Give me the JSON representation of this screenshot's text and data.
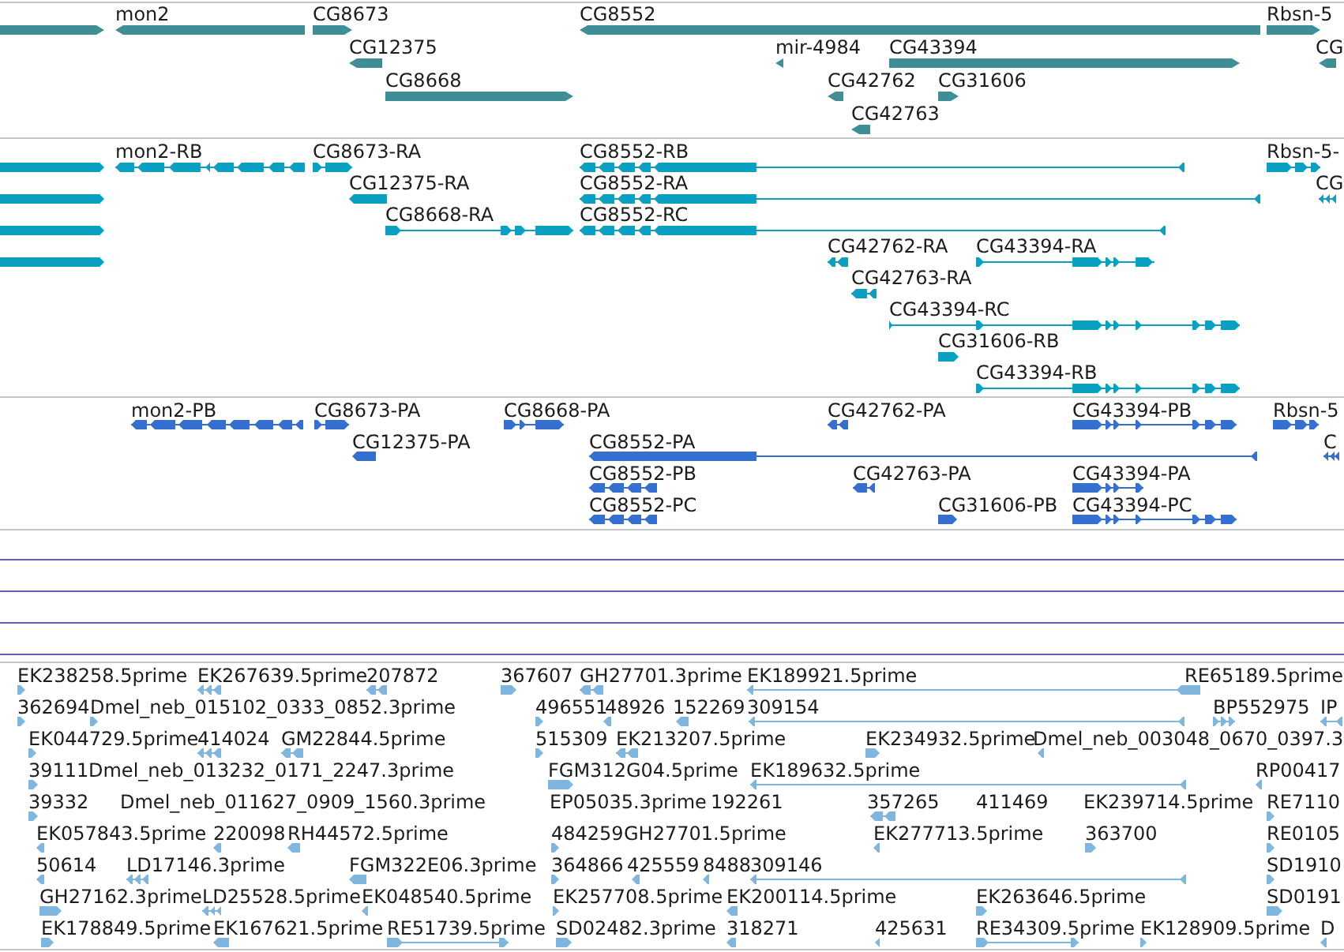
{
  "tracks": [
    {
      "kind": "gene",
      "rows": [
        {
          "features": [
            {
              "reverse": false
            },
            {
              "label": "mon2",
              "reverse": true
            },
            {
              "label": "CG8673",
              "reverse": false
            },
            {
              "label": "CG8552",
              "reverse": true
            },
            {
              "label": "Rbsn-5",
              "reverse": false
            }
          ]
        },
        {
          "features": [
            {
              "label": "CG12375",
              "reverse": true
            },
            {
              "label": "mir-4984",
              "reverse": true
            },
            {
              "label": "CG43394",
              "reverse": false
            },
            {
              "label": "CG",
              "reverse": true
            }
          ]
        },
        {
          "features": [
            {
              "label": "CG8668",
              "reverse": false
            },
            {
              "label": "CG42762",
              "reverse": true
            },
            {
              "label": "CG31606",
              "reverse": false
            }
          ]
        },
        {
          "features": [
            {
              "label": "CG42763",
              "reverse": true
            }
          ]
        }
      ]
    },
    {
      "kind": "transcript",
      "rows": [
        {
          "features": [
            {
              "reverse": false
            },
            {
              "label": "mon2-RB",
              "reverse": true
            },
            {
              "label": "CG8673-RA",
              "reverse": false
            },
            {
              "label": "CG8552-RB",
              "reverse": true
            },
            {
              "label": "Rbsn-5-",
              "reverse": false
            }
          ]
        },
        {
          "features": [
            {
              "reverse": false
            },
            {
              "label": "CG12375-RA",
              "reverse": true
            },
            {
              "label": "CG8552-RA",
              "reverse": true
            },
            {
              "label": "CG",
              "reverse": true
            }
          ]
        },
        {
          "features": [
            {
              "reverse": false
            },
            {
              "label": "CG8668-RA",
              "reverse": false
            },
            {
              "label": "CG8552-RC",
              "reverse": true
            }
          ]
        },
        {
          "features": [
            {
              "reverse": false
            },
            {
              "label": "CG42762-RA",
              "reverse": true
            },
            {
              "label": "CG43394-RA",
              "reverse": false
            }
          ]
        },
        {
          "features": [
            {
              "label": "CG42763-RA",
              "reverse": true
            }
          ]
        },
        {
          "features": [
            {
              "label": "CG43394-RC",
              "reverse": false
            }
          ]
        },
        {
          "features": [
            {
              "label": "CG31606-RB",
              "reverse": false
            }
          ]
        },
        {
          "features": [
            {
              "label": "CG43394-RB",
              "reverse": false
            }
          ]
        }
      ]
    },
    {
      "kind": "protein",
      "rows": [
        {
          "features": [
            {
              "label": "mon2-PB",
              "reverse": true
            },
            {
              "label": "CG8673-PA",
              "reverse": false
            },
            {
              "label": "CG8668-PA",
              "reverse": false
            },
            {
              "label": "CG42762-PA",
              "reverse": true
            },
            {
              "label": "CG43394-PB",
              "reverse": false
            },
            {
              "label": "Rbsn-5",
              "reverse": false
            }
          ]
        },
        {
          "features": [
            {
              "label": "CG12375-PA",
              "reverse": true
            },
            {
              "label": "CG8552-PA",
              "reverse": true
            },
            {
              "label": "C",
              "reverse": true
            }
          ]
        },
        {
          "features": [
            {
              "label": "CG8552-PB",
              "reverse": true
            },
            {
              "label": "CG42763-PA",
              "reverse": true
            },
            {
              "label": "CG43394-PA",
              "reverse": false
            }
          ]
        },
        {
          "features": [
            {
              "label": "CG8552-PC",
              "reverse": true
            },
            {
              "label": "CG31606-PB",
              "reverse": false
            },
            {
              "label": "CG43394-PC",
              "reverse": false
            }
          ]
        }
      ]
    },
    {
      "kind": "empty"
    },
    {
      "kind": "empty"
    },
    {
      "kind": "empty"
    },
    {
      "kind": "empty"
    },
    {
      "kind": "est",
      "rows": [
        {
          "features": [
            {
              "label": "EK238258.5prime",
              "reverse": false
            },
            {
              "label": "EK267639.5prime",
              "reverse": true
            },
            {
              "label": "207872",
              "reverse": true
            },
            {
              "label": "367607",
              "reverse": false
            },
            {
              "label": "GH27701.3prime",
              "reverse": true
            },
            {
              "label": "EK189921.5prime",
              "reverse": true
            },
            {
              "label": "RE65189.5prime"
            }
          ]
        },
        {
          "features": [
            {
              "label": "362694",
              "reverse": false
            },
            {
              "label": "Dmel_neb_015102_0333_0852.3prime",
              "reverse": false
            },
            {
              "label": "496551",
              "reverse": false
            },
            {
              "label": "48926",
              "reverse": true
            },
            {
              "label": "152269",
              "reverse": true
            },
            {
              "label": "309154",
              "reverse": true
            },
            {
              "label": "BP552975",
              "reverse": false
            },
            {
              "label": "IP",
              "reverse": true
            }
          ]
        },
        {
          "features": [
            {
              "label": "EK044729.5prime",
              "reverse": false
            },
            {
              "label": "414024",
              "reverse": true
            },
            {
              "label": "GM22844.5prime",
              "reverse": true
            },
            {
              "label": "515309",
              "reverse": false
            },
            {
              "label": "EK213207.5prime",
              "reverse": true
            },
            {
              "label": "EK234932.5prime",
              "reverse": false
            },
            {
              "label": "Dmel_neb_003048_0670_0397.3",
              "reverse": true
            }
          ]
        },
        {
          "features": [
            {
              "label": "39111",
              "reverse": false
            },
            {
              "label": "Dmel_neb_013232_0171_2247.3prime"
            },
            {
              "label": "FGM312G04.5prime",
              "reverse": false
            },
            {
              "label": "EK189632.5prime",
              "reverse": true
            },
            {
              "label": "RP00417",
              "reverse": true
            }
          ]
        },
        {
          "features": [
            {
              "label": "39332",
              "reverse": false
            },
            {
              "label": "Dmel_neb_011627_0909_1560.3prime"
            },
            {
              "label": "EP05035.3prime"
            },
            {
              "label": "192261"
            },
            {
              "label": "357265",
              "reverse": true
            },
            {
              "label": "411469"
            },
            {
              "label": "EK239714.5prime"
            },
            {
              "label": "RE7110",
              "reverse": false
            }
          ]
        },
        {
          "features": [
            {
              "label": "EK057843.5prime",
              "reverse": true
            },
            {
              "label": "220098",
              "reverse": true
            },
            {
              "label": "RH44572.5prime",
              "reverse": true
            },
            {
              "label": "484259",
              "reverse": false
            },
            {
              "label": "GH27701.5prime"
            },
            {
              "label": "EK277713.5prime",
              "reverse": true
            },
            {
              "label": "363700",
              "reverse": false
            },
            {
              "label": "RE0105",
              "reverse": false
            }
          ]
        },
        {
          "features": [
            {
              "label": "50614",
              "reverse": true
            },
            {
              "label": "LD17146.3prime",
              "reverse": true
            },
            {
              "label": "FGM322E06.3prime",
              "reverse": true
            },
            {
              "label": "364866",
              "reverse": false
            },
            {
              "label": "425559",
              "reverse": true
            },
            {
              "label": "8488",
              "reverse": true
            },
            {
              "label": "309146",
              "reverse": true
            },
            {
              "label": "SD1910",
              "reverse": false
            }
          ]
        },
        {
          "features": [
            {
              "label": "GH27162.3prime",
              "reverse": false
            },
            {
              "label": "LD25528.5prime",
              "reverse": true
            },
            {
              "label": "EK048540.5prime",
              "reverse": true
            },
            {
              "label": "EK257708.5prime",
              "reverse": false
            },
            {
              "label": "EK200114.5prime",
              "reverse": true
            },
            {
              "label": "EK263646.5prime",
              "reverse": false
            },
            {
              "label": "SD0191",
              "reverse": false
            }
          ]
        },
        {
          "features": [
            {
              "label": "EK178849.5prime",
              "reverse": false
            },
            {
              "label": "EK167621.5prime",
              "reverse": true
            },
            {
              "label": "RE51739.5prime",
              "reverse": false
            },
            {
              "label": "SD02482.3prime",
              "reverse": false
            },
            {
              "label": "318271",
              "reverse": true
            },
            {
              "label": "425631",
              "reverse": true
            },
            {
              "label": "RE34309.5prime",
              "reverse": false
            },
            {
              "label": "EK128909.5prime",
              "reverse": false
            },
            {
              "label": "D",
              "reverse": true
            }
          ]
        }
      ]
    }
  ]
}
